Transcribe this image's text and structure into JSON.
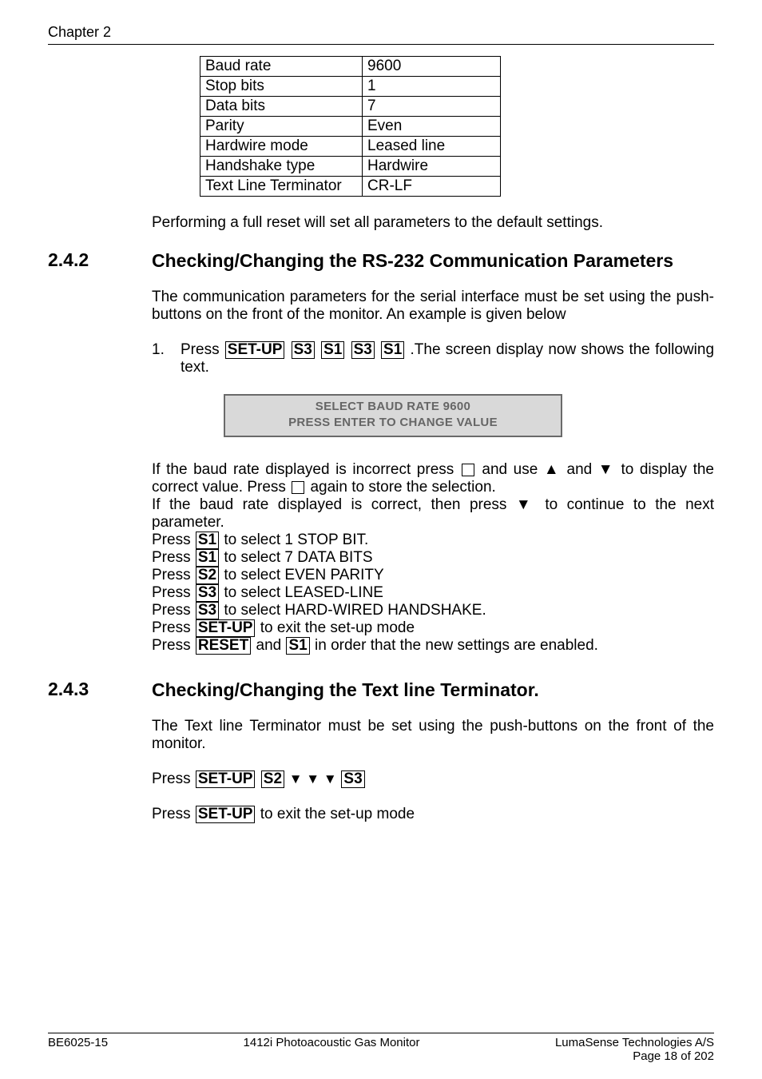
{
  "header": {
    "chapter": "Chapter 2"
  },
  "table": {
    "rows": [
      {
        "k": "Baud rate",
        "v": "9600"
      },
      {
        "k": "Stop bits",
        "v": "1"
      },
      {
        "k": "Data bits",
        "v": "7"
      },
      {
        "k": "Parity",
        "v": "Even"
      },
      {
        "k": "Hardwire mode",
        "v": "Leased line"
      },
      {
        "k": "Handshake type",
        "v": "Hardwire"
      },
      {
        "k": "Text Line Terminator",
        "v": "CR-LF"
      }
    ]
  },
  "para_reset": "Performing a full reset will set all parameters to the default settings.",
  "section242": {
    "num": "2.4.2",
    "title": "Checking/Changing the RS-232 Communication Parameters",
    "p1": "The communication parameters for the serial interface must be set using the push-buttons on the front of the monitor. An example is given below",
    "list1_num": "1.",
    "list1_a": "Press ",
    "list1_b": " .The screen display now shows the following text.",
    "keys": {
      "setup": "SET-UP",
      "s1": "S1",
      "s2": "S2",
      "s3": "S3",
      "reset": "RESET"
    },
    "lcd": {
      "l1": "SELECT BAUD RATE 9600",
      "l2": "PRESS ENTER TO CHANGE VALUE"
    },
    "baud_a": "If the baud rate displayed is incorrect press ",
    "baud_b": " and use ▲ and ▼ to display the correct value. Press ",
    "baud_c": " again to store the selection.",
    "baud_d": "If the baud rate displayed is correct, then press ▼ to continue to the next parameter.",
    "press": "Press ",
    "line_s1a": " to select 1 STOP BIT.",
    "line_s1b": " to select 7 DATA BITS",
    "line_s2": " to select EVEN PARITY",
    "line_s3a": " to select LEASED-LINE",
    "line_s3b": " to select HARD-WIRED HANDSHAKE.",
    "line_setup": " to exit the set-up mode",
    "line_reset_a": " and ",
    "line_reset_b": " in order that the new settings are enabled."
  },
  "section243": {
    "num": "2.4.3",
    "title": "Checking/Changing the Text line Terminator.",
    "p1": "The Text line Terminator must be set using the push-buttons on the front of the monitor.",
    "press": "Press ",
    "arrows": " ▼ ▼ ▼ ",
    "exit": " to exit the set-up mode"
  },
  "footer": {
    "left": "BE6025-15",
    "center": "1412i Photoacoustic Gas Monitor",
    "right1": "LumaSense Technologies A/S",
    "right2": "Page 18 of 202"
  }
}
